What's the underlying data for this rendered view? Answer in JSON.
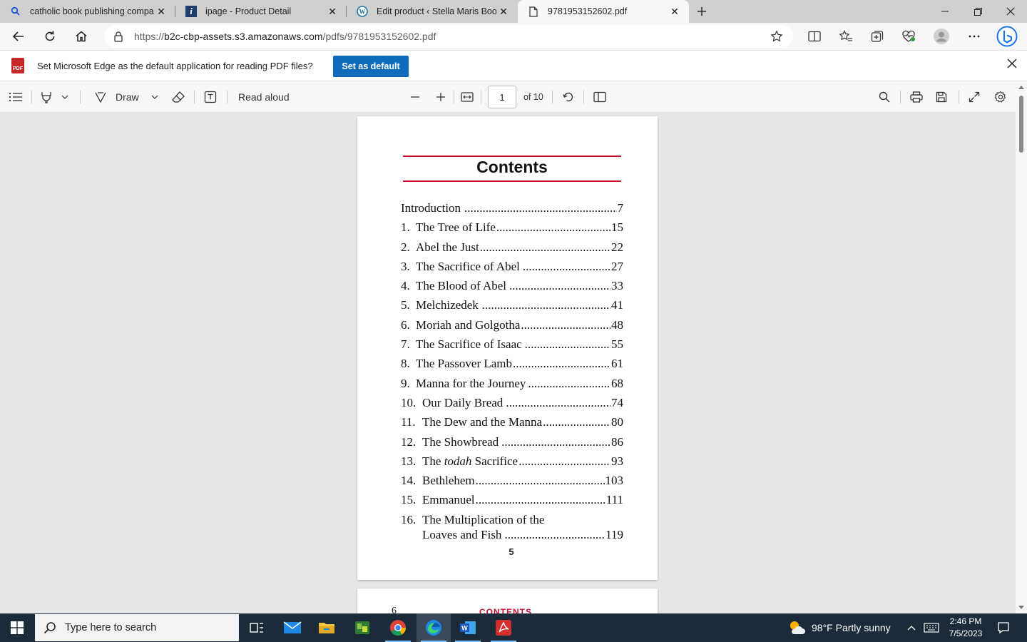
{
  "browser": {
    "tabs": [
      {
        "title": "catholic book publishing compan",
        "icon": "search-icon"
      },
      {
        "title": "ipage - Product Detail",
        "icon": "ipage-logo-icon"
      },
      {
        "title": "Edit product ‹ Stella Maris Books",
        "icon": "wordpress-icon"
      },
      {
        "title": "9781953152602.pdf",
        "icon": "document-icon",
        "active": true
      }
    ],
    "url_prefix": "https://",
    "url_host": "b2c-cbp-assets.s3.amazonaws.com",
    "url_path": "/pdfs/9781953152602.pdf"
  },
  "infobar": {
    "message": "Set Microsoft Edge as the default application for reading PDF files?",
    "button_label": "Set as default",
    "badge": "PDF"
  },
  "pdf_toolbar": {
    "draw_label": "Draw",
    "read_aloud_label": "Read aloud",
    "page_value": "1",
    "page_total": "of 10"
  },
  "pdf_page": {
    "title": "Contents",
    "entries": [
      {
        "num": "",
        "title": "Introduction",
        "page": "7"
      },
      {
        "num": "1.",
        "title": "The Tree of Life",
        "page": "15"
      },
      {
        "num": "2.",
        "title": "Abel the Just",
        "page": "22"
      },
      {
        "num": "3.",
        "title": "The Sacrifice of Abel",
        "page": "27"
      },
      {
        "num": "4.",
        "title": "The Blood of Abel",
        "page": "33"
      },
      {
        "num": "5.",
        "title": "Melchizedek",
        "page": "41"
      },
      {
        "num": "6.",
        "title": "Moriah and Golgotha",
        "page": "48"
      },
      {
        "num": "7.",
        "title": "The Sacrifice of Isaac",
        "page": "55"
      },
      {
        "num": "8.",
        "title": "The Passover Lamb",
        "page": "61"
      },
      {
        "num": "9.",
        "title": "Manna for the Journey",
        "page": "68"
      },
      {
        "num": "10.",
        "title": "Our Daily Bread",
        "page": "74"
      },
      {
        "num": "11.",
        "title": "The Dew and the Manna",
        "page": "80"
      },
      {
        "num": "12.",
        "title": "The Showbread",
        "page": "86"
      },
      {
        "num": "13.",
        "title_pre": "The ",
        "title_em": "todah",
        "title_post": " Sacrifice",
        "page": "93"
      },
      {
        "num": "14.",
        "title": "Bethlehem",
        "page": "103"
      },
      {
        "num": "15.",
        "title": "Emmanuel",
        "page": "111"
      },
      {
        "num": "16.",
        "title": "The Multiplication of the",
        "title2": "Loaves and Fish",
        "page": "119"
      }
    ],
    "page_number": "5",
    "next_page_number": "6",
    "next_page_header": "CONTENTS",
    "accent_color": "#c8102e"
  },
  "taskbar": {
    "search_placeholder": "Type here to search",
    "weather": "98°F  Partly sunny",
    "time": "2:46 PM",
    "date": "7/5/2023"
  }
}
